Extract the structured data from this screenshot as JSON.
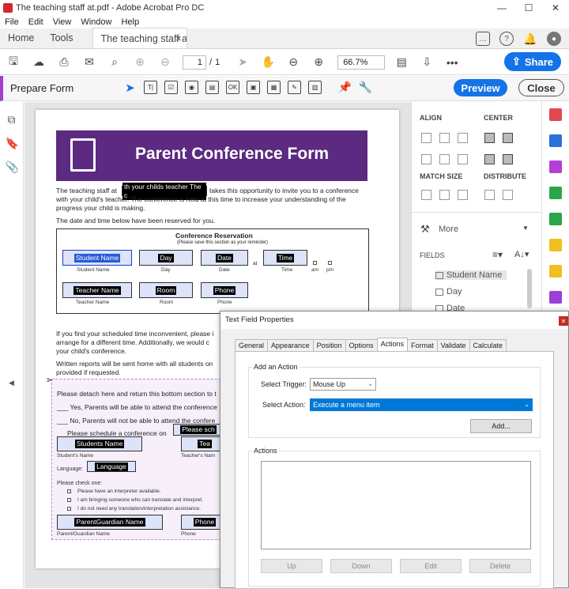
{
  "window": {
    "title": "The teaching staff at.pdf - Adobe Acrobat Pro DC",
    "minimize": "—",
    "maximize": "☐",
    "close": "✕"
  },
  "menu": [
    "File",
    "Edit",
    "View",
    "Window",
    "Help"
  ],
  "tabs": {
    "home": "Home",
    "tools": "Tools",
    "doc": "The teaching staff a...",
    "doc_close": "×"
  },
  "toolbar": {
    "page_current": "1",
    "page_sep": "/",
    "page_total": "1",
    "zoom": "66.7%",
    "share": "Share",
    "more": "•••"
  },
  "prepare": {
    "label": "Prepare Form",
    "tools": [
      "T|",
      "☑",
      "◉",
      "▤",
      "OK",
      "▣",
      "▦",
      "✎",
      "▥"
    ],
    "preview": "Preview",
    "close": "Close"
  },
  "pdf": {
    "title": "Parent Conference Form",
    "intro_a": "The teaching staff at",
    "intro_field": "th your childs teacher  The c",
    "intro_b": "takes this opportunity to invite you to a conference",
    "intro_c": "with your child's teacher.  The conference is held at this time to increase your understanding of the",
    "intro_d": "progress your child is making.",
    "reserved": "The date and time below have been reserved for you.",
    "res_title": "Conference Reservation",
    "res_sub": "(Please save this section as your reminder)",
    "f_student": "Student Name",
    "l_student": "Student Name",
    "f_day": "Day",
    "l_day": "Day",
    "f_date": "Date",
    "l_date": "Date",
    "at": "at",
    "f_time": "Time",
    "l_time": "Time",
    "am": "am",
    "pm": "pm",
    "f_teacher": "Teacher Name",
    "l_teacher": "Teacher Name",
    "f_room": "Room",
    "l_room": "Room",
    "f_phone": "Phone",
    "l_phone": "Phone",
    "incon_a": "If you find your scheduled time inconvenient, please i",
    "incon_b": "arrange for a different time.  Additionally, we would c",
    "incon_c": "your child's conference.",
    "written_a": "Written reports will be sent home with all students on",
    "written_b": "provided if requested.",
    "detach": "Please detach here and return this bottom section to t",
    "yes": "___ Yes, Parents will be able to attend the conference",
    "no": "___ No, Parents will not be able to attend the confere",
    "schedule": "Please schedule a conference on",
    "f_please": "Please sch",
    "f_students": "Students Name",
    "l_students": "Student's Name",
    "f_te": "Tea",
    "l_te": "Teacher's Nam",
    "language_lbl": "Language:",
    "f_language": "Language",
    "check": "Please check one:",
    "opt1": "Please have an interpreter available.",
    "opt2": "I am bringing someone who can translate and interpret.",
    "opt3": "I do not need any translation/interpretation assistance.",
    "f_parent": "ParentGuardian Name",
    "l_parent": "Parent/Guardian Name",
    "f_phone2": "Phone",
    "l_phone2": "Phone"
  },
  "panel": {
    "align": "ALIGN",
    "center": "CENTER",
    "match": "MATCH SIZE",
    "distribute": "DISTRIBUTE",
    "more": "More",
    "fields": "FIELDS",
    "items": [
      "Student Name",
      "Day",
      "Date"
    ]
  },
  "dialog": {
    "title": "Text Field Properties",
    "tabs": [
      "General",
      "Appearance",
      "Position",
      "Options",
      "Actions",
      "Format",
      "Validate",
      "Calculate"
    ],
    "add_action": "Add an Action",
    "trigger_lbl": "Select Trigger:",
    "trigger": "Mouse Up",
    "action_lbl": "Select Action:",
    "action": "Execute a menu item",
    "add_btn": "Add...",
    "actions_lbl": "Actions",
    "up": "Up",
    "down": "Down",
    "edit": "Edit",
    "delete": "Delete"
  },
  "colors": {
    "accent": "#1473e6",
    "banner": "#5c2a80",
    "prep_stripe": "#a03cd6"
  }
}
